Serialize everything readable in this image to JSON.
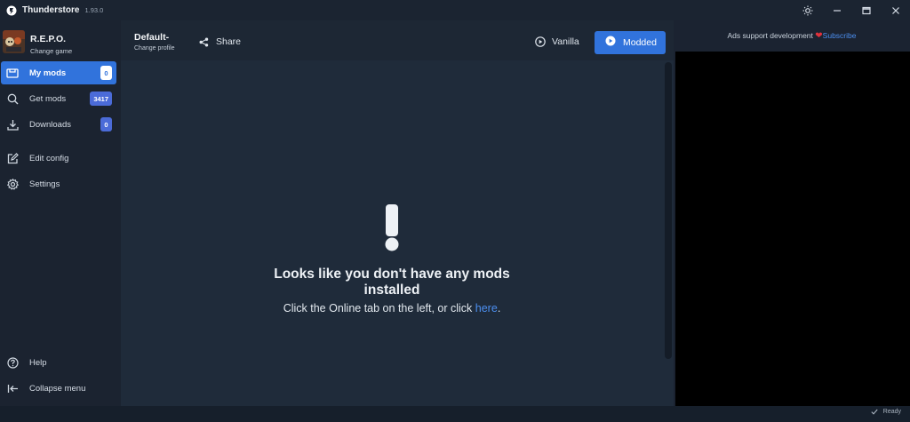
{
  "app": {
    "name": "Thunderstore",
    "version": "1.93.0"
  },
  "game": {
    "name": "R.E.P.O.",
    "change_label": "Change game"
  },
  "profile": {
    "name": "Default-",
    "change_label": "Change profile"
  },
  "toolbar": {
    "share_label": "Share",
    "vanilla_label": "Vanilla",
    "modded_label": "Modded"
  },
  "sidebar": {
    "items": [
      {
        "label": "My mods",
        "badge": "0",
        "icon": "puzzle-icon",
        "active": true
      },
      {
        "label": "Get mods",
        "badge": "3417",
        "icon": "search-icon"
      },
      {
        "label": "Downloads",
        "badge": "0",
        "icon": "download-icon"
      },
      {
        "label": "Edit config",
        "icon": "edit-icon"
      },
      {
        "label": "Settings",
        "icon": "gear-icon"
      }
    ],
    "footer": [
      {
        "label": "Help",
        "icon": "help-icon"
      },
      {
        "label": "Collapse menu",
        "icon": "collapse-icon"
      }
    ]
  },
  "empty_state": {
    "title": "Looks like you don't have any mods installed",
    "line_prefix": "Click the Online tab on the left, or click ",
    "link": "here",
    "line_suffix": "."
  },
  "ads": {
    "text": "Ads support development",
    "link": "Subscribe"
  },
  "status": {
    "text": "Ready"
  },
  "colors": {
    "accent": "#3173dc",
    "link": "#4c8ff0",
    "heart": "#e0313b"
  }
}
